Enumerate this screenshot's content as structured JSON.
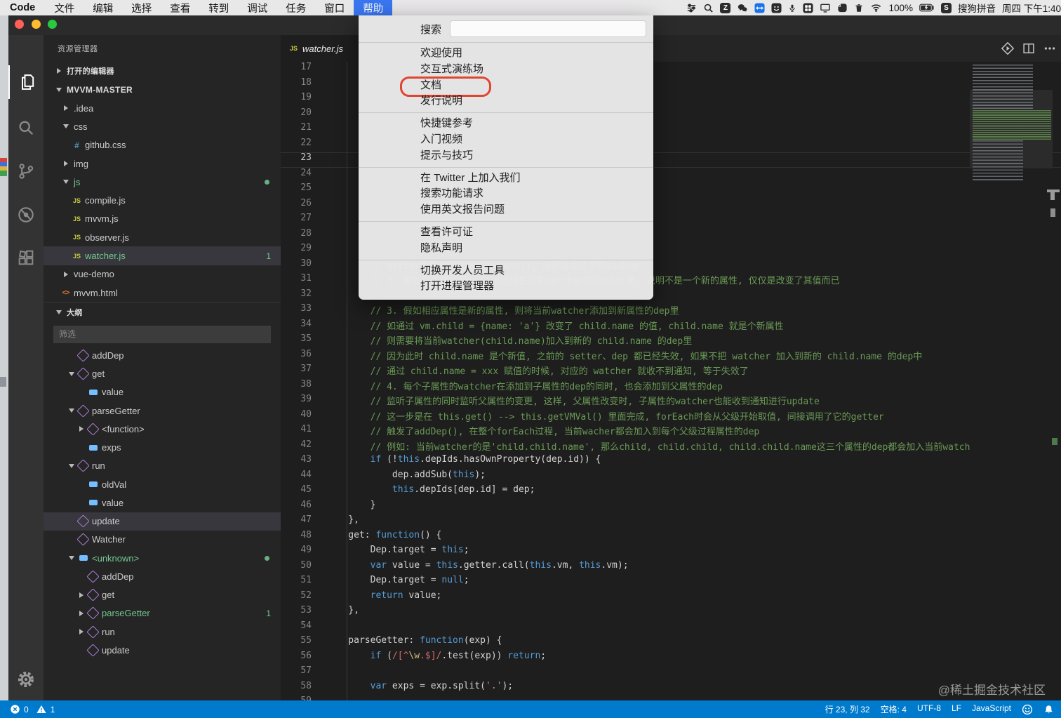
{
  "colors": {
    "statusbar_accent": "#007ACC",
    "git_modified_green": "#73C991",
    "selection_bg": "#37373D",
    "menu_highlight_blue": "#3A76F0",
    "annotation_red": "#E0452F",
    "comment_green": "#6A9955",
    "keyword_blue": "#569CD6"
  },
  "menubar": {
    "app": "Code",
    "items": [
      "文件",
      "编辑",
      "选择",
      "查看",
      "转到",
      "调试",
      "任务",
      "窗口"
    ],
    "help": "帮助",
    "tray": [
      {
        "icon": "keyboard-switch-icon"
      },
      {
        "icon": "spotlight-search-icon"
      },
      {
        "icon": "app-z-icon",
        "letter": "Z"
      },
      {
        "icon": "wechat-icon"
      },
      {
        "icon": "teamviewer-icon"
      },
      {
        "icon": "smiley-app-icon"
      },
      {
        "icon": "microphone-icon"
      },
      {
        "icon": "grid-app-icon"
      },
      {
        "icon": "display-icon"
      },
      {
        "icon": "evernote-icon"
      },
      {
        "icon": "trash-icon"
      },
      {
        "icon": "wifi-icon"
      },
      {
        "text": "100%"
      },
      {
        "icon": "battery-icon"
      },
      {
        "icon": "sogou-icon",
        "letter": "S"
      },
      {
        "text": "搜狗拼音"
      },
      {
        "text": "周四 下午1:40"
      }
    ]
  },
  "help_menu": {
    "rows": [
      {
        "type": "search",
        "label": "搜索"
      },
      {
        "type": "sep"
      },
      {
        "type": "item",
        "label": "欢迎使用"
      },
      {
        "type": "item",
        "label": "交互式演练场"
      },
      {
        "type": "item",
        "label": "文档",
        "annotated": true
      },
      {
        "type": "item",
        "label": "发行说明"
      },
      {
        "type": "sep"
      },
      {
        "type": "item",
        "label": "快捷键参考"
      },
      {
        "type": "item",
        "label": "入门视频"
      },
      {
        "type": "item",
        "label": "提示与技巧"
      },
      {
        "type": "sep"
      },
      {
        "type": "item",
        "label": "在 Twitter 上加入我们"
      },
      {
        "type": "item",
        "label": "搜索功能请求"
      },
      {
        "type": "item",
        "label": "使用英文报告问题"
      },
      {
        "type": "sep"
      },
      {
        "type": "item",
        "label": "查看许可证"
      },
      {
        "type": "item",
        "label": "隐私声明"
      },
      {
        "type": "sep"
      },
      {
        "type": "item",
        "label": "切换开发人员工具"
      },
      {
        "type": "item",
        "label": "打开进程管理器"
      }
    ]
  },
  "sidebar": {
    "title": "资源管理器",
    "open_editors": "打开的编辑器",
    "root": "MVVM-MASTER",
    "tree": [
      {
        "lvl": 1,
        "arrow": "r",
        "label": ".idea"
      },
      {
        "lvl": 1,
        "arrow": "d",
        "label": "css"
      },
      {
        "lvl": 2,
        "icon": "css",
        "label": "github.css"
      },
      {
        "lvl": 1,
        "arrow": "r",
        "label": "img"
      },
      {
        "lvl": 1,
        "arrow": "d",
        "label": "js",
        "green": true,
        "dot": true
      },
      {
        "lvl": 2,
        "icon": "js",
        "label": "compile.js"
      },
      {
        "lvl": 2,
        "icon": "js",
        "label": "mvvm.js"
      },
      {
        "lvl": 2,
        "icon": "js",
        "label": "observer.js"
      },
      {
        "lvl": 2,
        "icon": "js",
        "label": "watcher.js",
        "green": true,
        "badge": "1",
        "sel": true
      },
      {
        "lvl": 1,
        "arrow": "r",
        "label": "vue-demo"
      },
      {
        "lvl": 1,
        "icon": "html",
        "label": "mvvm.html"
      }
    ],
    "outline_title": "大纲",
    "filter_placeholder": "筛选",
    "outline": [
      {
        "lvl": 0,
        "icon": "m",
        "label": "addDep"
      },
      {
        "lvl": 0,
        "arrow": "d",
        "icon": "m",
        "label": "get"
      },
      {
        "lvl": 1,
        "icon": "f",
        "label": "value"
      },
      {
        "lvl": 0,
        "arrow": "d",
        "icon": "m",
        "label": "parseGetter"
      },
      {
        "lvl": 1,
        "arrow": "r",
        "icon": "m",
        "label": "<function>"
      },
      {
        "lvl": 1,
        "icon": "f",
        "label": "exps"
      },
      {
        "lvl": 0,
        "arrow": "d",
        "icon": "m",
        "label": "run"
      },
      {
        "lvl": 1,
        "icon": "f",
        "label": "oldVal"
      },
      {
        "lvl": 1,
        "icon": "f",
        "label": "value"
      },
      {
        "lvl": 0,
        "icon": "m",
        "label": "update",
        "sel": true
      },
      {
        "lvl": 0,
        "icon": "m",
        "label": "Watcher"
      },
      {
        "lvl": 0,
        "arrow": "d",
        "icon": "f",
        "label": "<unknown>",
        "green": true,
        "dot": true
      },
      {
        "lvl": 1,
        "icon": "m",
        "label": "addDep"
      },
      {
        "lvl": 1,
        "arrow": "r",
        "icon": "m",
        "label": "get"
      },
      {
        "lvl": 1,
        "arrow": "r",
        "icon": "m",
        "label": "parseGetter",
        "green": true,
        "badge": "1"
      },
      {
        "lvl": 1,
        "arrow": "r",
        "icon": "m",
        "label": "run"
      },
      {
        "lvl": 1,
        "icon": "m",
        "label": "update"
      }
    ]
  },
  "tab": {
    "icon": "JS",
    "label": "watcher.js"
  },
  "editor": {
    "lines": [
      {
        "n": 17,
        "seg": []
      },
      {
        "n": 18,
        "seg": []
      },
      {
        "n": 19,
        "seg": []
      },
      {
        "n": 20,
        "seg": []
      },
      {
        "n": 21,
        "seg": []
      },
      {
        "n": 22,
        "seg": []
      },
      {
        "n": 23,
        "seg": [],
        "cur": true
      },
      {
        "n": 24,
        "seg": []
      },
      {
        "n": 25,
        "seg": []
      },
      {
        "n": 26,
        "seg": []
      },
      {
        "n": 27,
        "seg": []
      },
      {
        "n": 28,
        "seg": []
      },
      {
        "n": 29,
        "seg": []
      },
      {
        "n": 30,
        "seg": [
          [
            "        // getter里面会触发dep.depend(), 继而触发这里的addDep",
            "c"
          ]
        ]
      },
      {
        "n": 31,
        "seg": [
          [
            "        // 2. 假如相应属性的dep.id已经在当前watcher的depIds里, 说明不是一个新的属性, 仅仅是改变了其值而已",
            "c"
          ]
        ]
      },
      {
        "n": 32,
        "seg": []
      },
      {
        "n": 33,
        "seg": [
          [
            "        // 3. 假如相应属性是新的属性, 则将当前watcher添加到新属性的dep里",
            "c"
          ]
        ]
      },
      {
        "n": 34,
        "seg": [
          [
            "        // 如通过 vm.child = {name: 'a'} 改变了 child.name 的值, child.name 就是个新属性",
            "c"
          ]
        ]
      },
      {
        "n": 35,
        "seg": [
          [
            "        // 则需要将当前watcher(child.name)加入到新的 child.name 的dep里",
            "c"
          ]
        ]
      },
      {
        "n": 36,
        "seg": [
          [
            "        // 因为此时 child.name 是个新值, 之前的 setter、dep 都已经失效, 如果不把 watcher 加入到新的 child.name 的dep中",
            "c"
          ]
        ]
      },
      {
        "n": 37,
        "seg": [
          [
            "        // 通过 child.name = xxx 赋值的时候, 对应的 watcher 就收不到通知, 等于失效了",
            "c"
          ]
        ]
      },
      {
        "n": 38,
        "seg": [
          [
            "        // 4. 每个子属性的watcher在添加到子属性的dep的同时, 也会添加到父属性的dep",
            "c"
          ]
        ]
      },
      {
        "n": 39,
        "seg": [
          [
            "        // 监听子属性的同时监听父属性的变更, 这样, 父属性改变时, 子属性的watcher也能收到通知进行update",
            "c"
          ]
        ]
      },
      {
        "n": 40,
        "seg": [
          [
            "        // 这一步是在 this.get() --> this.getVMVal() 里面完成, forEach时会从父级开始取值, 间接调用了它的getter",
            "c"
          ]
        ]
      },
      {
        "n": 41,
        "seg": [
          [
            "        // 触发了addDep(), 在整个forEach过程, 当前wacher都会加入到每个父级过程属性的dep",
            "c"
          ]
        ]
      },
      {
        "n": 42,
        "seg": [
          [
            "        // 例如: 当前watcher的是'child.child.name', 那么child, child.child, child.child.name这三个属性的dep都会加入当前watcher",
            "c"
          ]
        ]
      },
      {
        "n": 43,
        "seg": [
          [
            "        ",
            "p"
          ],
          [
            "if",
            "k"
          ],
          [
            " (!",
            "p"
          ],
          [
            "this",
            "k"
          ],
          [
            ".depIds.hasOwnProperty(dep.id)) {",
            "p"
          ]
        ]
      },
      {
        "n": 44,
        "seg": [
          [
            "            dep.addSub(",
            "p"
          ],
          [
            "this",
            "k"
          ],
          [
            ");",
            "p"
          ]
        ]
      },
      {
        "n": 45,
        "seg": [
          [
            "            ",
            "p"
          ],
          [
            "this",
            "k"
          ],
          [
            ".depIds[dep.id] = dep;",
            "p"
          ]
        ]
      },
      {
        "n": 46,
        "seg": [
          [
            "        }",
            "p"
          ]
        ]
      },
      {
        "n": 47,
        "seg": [
          [
            "    },",
            "p"
          ]
        ]
      },
      {
        "n": 48,
        "seg": [
          [
            "    get: ",
            "p"
          ],
          [
            "function",
            "k"
          ],
          [
            "() {",
            "p"
          ]
        ]
      },
      {
        "n": 49,
        "seg": [
          [
            "        Dep.target = ",
            "p"
          ],
          [
            "this",
            "k"
          ],
          [
            ";",
            "p"
          ]
        ]
      },
      {
        "n": 50,
        "seg": [
          [
            "        ",
            "p"
          ],
          [
            "var",
            "k"
          ],
          [
            " value = ",
            "p"
          ],
          [
            "this",
            "k"
          ],
          [
            ".getter.call(",
            "p"
          ],
          [
            "this",
            "k"
          ],
          [
            ".vm, ",
            "p"
          ],
          [
            "this",
            "k"
          ],
          [
            ".vm);",
            "p"
          ]
        ]
      },
      {
        "n": 51,
        "seg": [
          [
            "        Dep.target = ",
            "p"
          ],
          [
            "null",
            "k"
          ],
          [
            ";",
            "p"
          ]
        ]
      },
      {
        "n": 52,
        "seg": [
          [
            "        ",
            "p"
          ],
          [
            "return",
            "k"
          ],
          [
            " value;",
            "p"
          ]
        ]
      },
      {
        "n": 53,
        "seg": [
          [
            "    },",
            "p"
          ]
        ]
      },
      {
        "n": 54,
        "seg": []
      },
      {
        "n": 55,
        "seg": [
          [
            "    parseGetter: ",
            "p"
          ],
          [
            "function",
            "k"
          ],
          [
            "(exp) {",
            "p"
          ]
        ]
      },
      {
        "n": 56,
        "seg": [
          [
            "        ",
            "p"
          ],
          [
            "if",
            "k"
          ],
          [
            " (",
            "p"
          ],
          [
            "/[^",
            "r"
          ],
          [
            "\\w",
            "e"
          ],
          [
            ".$]/",
            "r"
          ],
          [
            ".test(exp)) ",
            "p"
          ],
          [
            "return",
            "k"
          ],
          [
            ";",
            "p"
          ]
        ]
      },
      {
        "n": 57,
        "seg": []
      },
      {
        "n": 58,
        "seg": [
          [
            "        ",
            "p"
          ],
          [
            "var",
            "k"
          ],
          [
            " exps = exp.split(",
            "p"
          ],
          [
            "'.'",
            "s"
          ],
          [
            ");",
            "p"
          ]
        ]
      },
      {
        "n": 59,
        "seg": []
      }
    ]
  },
  "statusbar": {
    "errors": "0",
    "warnings": "1",
    "items": [
      "行 23, 列 32",
      "空格: 4",
      "UTF-8",
      "LF",
      "JavaScript"
    ]
  },
  "watermark": "@稀土掘金技术社区"
}
